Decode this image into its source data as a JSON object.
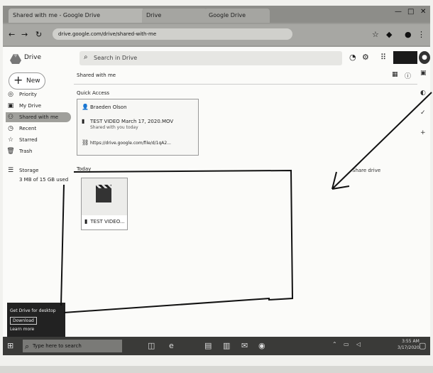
{
  "browser": {
    "tabs": [
      "Shared with me - Google Drive",
      "Drive",
      "Google Drive"
    ],
    "url": "drive.google.com/drive/shared-with-me",
    "window_controls": [
      "minimize-icon",
      "maximize-icon",
      "close-icon"
    ]
  },
  "drive": {
    "logo_text": "Drive",
    "search_placeholder": "Search in Drive",
    "new_label": "New",
    "sidebar": [
      {
        "label": "Priority",
        "icon": "priority-icon"
      },
      {
        "label": "My Drive",
        "icon": "drive-icon"
      },
      {
        "label": "Shared with me",
        "icon": "people-icon",
        "selected": true
      },
      {
        "label": "Recent",
        "icon": "clock-icon"
      },
      {
        "label": "Starred",
        "icon": "star-icon"
      },
      {
        "label": "Trash",
        "icon": "trash-icon"
      },
      {
        "label": "Storage",
        "icon": "storage-icon"
      }
    ],
    "storage_used": "3 MB of 15 GB used",
    "page_title": "Shared with me",
    "quick_access_label": "Quick Access",
    "quick_access": [
      {
        "title": "Braeden Olson",
        "icon": "person-icon"
      },
      {
        "title": "TEST VIDEO March 17, 2020.MOV",
        "subtitle": "Shared with you today",
        "icon": "video-icon"
      },
      {
        "title": "https://drive.google.com/file/d/1qA2...",
        "icon": "link-icon"
      }
    ],
    "files_label": "Today",
    "share_drive_label": "Share drive",
    "file": {
      "name": "TEST VIDEO...",
      "icon": "video-icon"
    },
    "desktop_promo": {
      "title": "Get Drive for desktop",
      "button": "Download",
      "link": "Learn more"
    }
  },
  "taskbar": {
    "search_text": "Type here to search",
    "time": "3:55 AM",
    "date": "3/17/2020"
  },
  "colors": {
    "accent": "#1a73e8",
    "selected_bg": "#9f9f9b",
    "taskbar": "#3a3a38"
  }
}
